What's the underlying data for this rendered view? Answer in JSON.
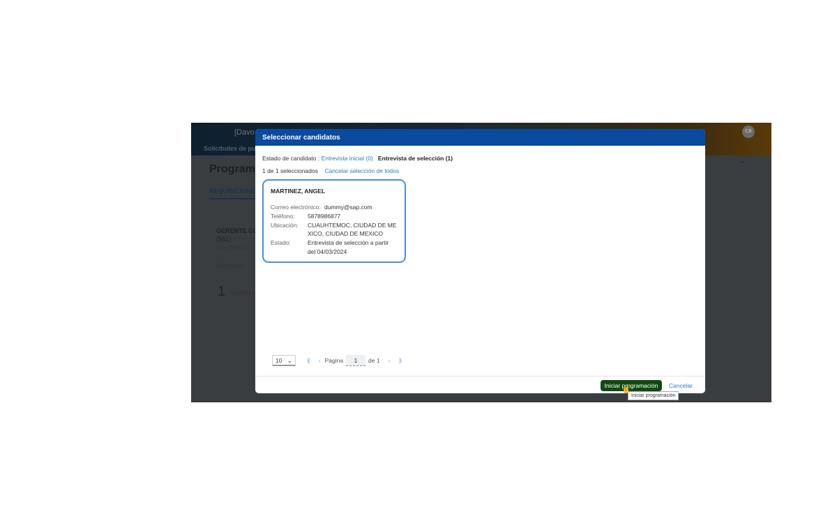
{
  "background": {
    "logo": "[Davo...",
    "nav": "Solicitudes de pu...",
    "avatar": "CB",
    "page_title": "Program...",
    "tab": "REQUISICIONE...",
    "job_title": "GERENTE CO...",
    "job_id": "(841)",
    "job_location": "COLOMBIA | ...",
    "recruiter": "Reclutador: ...",
    "candidate_count": "1",
    "candidate_label": "candidato..."
  },
  "modal": {
    "title": "Seleccionar candidatos",
    "status_label": "Estado de candidato :",
    "status_initial": "Entrevista inicial (0)",
    "status_selection": "Entrevista de selección (1)",
    "selected_count": "1 de 1 seleccionados",
    "cancel_all": "Cancelar selección de todos",
    "candidate": {
      "name": "MARTINEZ, ANGEL",
      "email_label": "Correo electrónico:",
      "email": "dummy@sap.com",
      "phone_label": "Teléfono:",
      "phone": "5878986877",
      "location_label": "Ubicación:",
      "location": "CUAUHTEMOC, CIUDAD DE MEXICO, CIUDAD DE MEXICO",
      "status_label": "Estado:",
      "status": "Entrevista de selección a partir del 04/03/2024"
    },
    "pager": {
      "page_size": "10",
      "page_label": "Página",
      "page": "1",
      "of": "de 1"
    },
    "start_button": "Iniciar programación",
    "cancel_button": "Cancelar",
    "tooltip": "Iniciar programación"
  },
  "colors": {
    "header": "#0a4a9f",
    "primary_button": "#0f4a10",
    "link": "#2a7bc8",
    "card_border": "#4a8fd0"
  }
}
